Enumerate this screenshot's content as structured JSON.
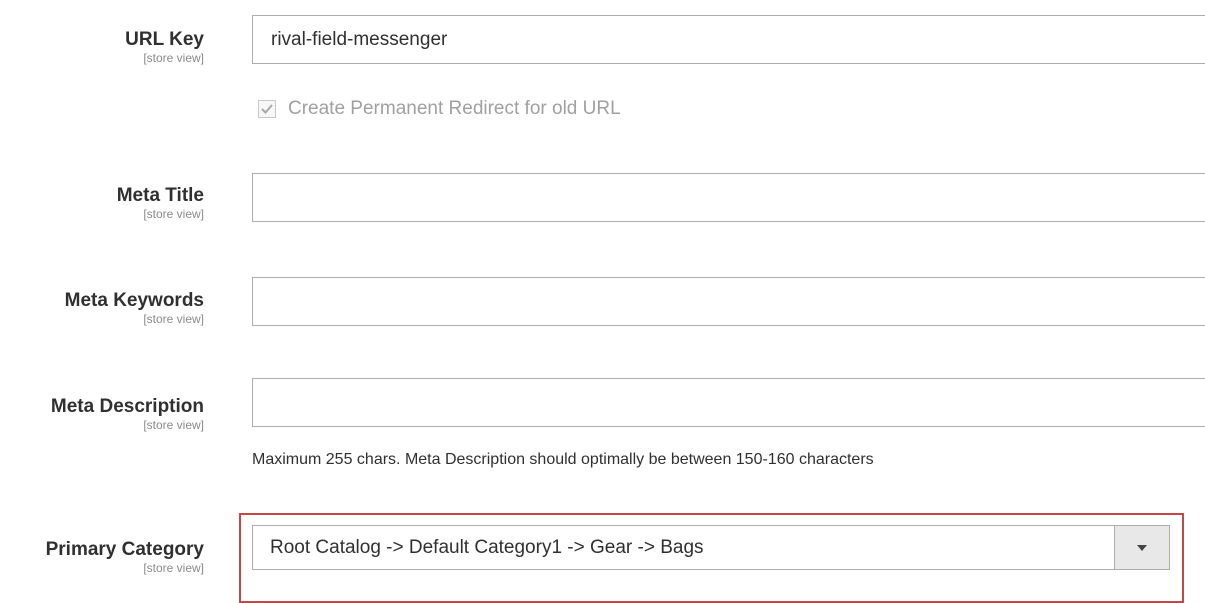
{
  "form": {
    "url_key": {
      "label": "URL Key",
      "scope": "[store view]",
      "value": "rival-field-messenger",
      "permanent_redirect": {
        "label": "Create Permanent Redirect for old URL",
        "checked": true
      }
    },
    "meta_title": {
      "label": "Meta Title",
      "scope": "[store view]",
      "value": ""
    },
    "meta_keywords": {
      "label": "Meta Keywords",
      "scope": "[store view]",
      "value": ""
    },
    "meta_description": {
      "label": "Meta Description",
      "scope": "[store view]",
      "value": "",
      "note": "Maximum 255 chars. Meta Description should optimally be between 150-160 characters"
    },
    "primary_category": {
      "label": "Primary Category",
      "scope": "[store view]",
      "selected": "Root Catalog -> Default Category1 -> Gear -> Bags"
    }
  },
  "colors": {
    "highlight_border": "#c64545",
    "input_border": "#adadad",
    "label_text": "#303030",
    "scope_text": "#8a8a8a"
  },
  "icons": {
    "checkbox_check": "checkmark-icon",
    "select_arrow": "caret-down-icon"
  }
}
